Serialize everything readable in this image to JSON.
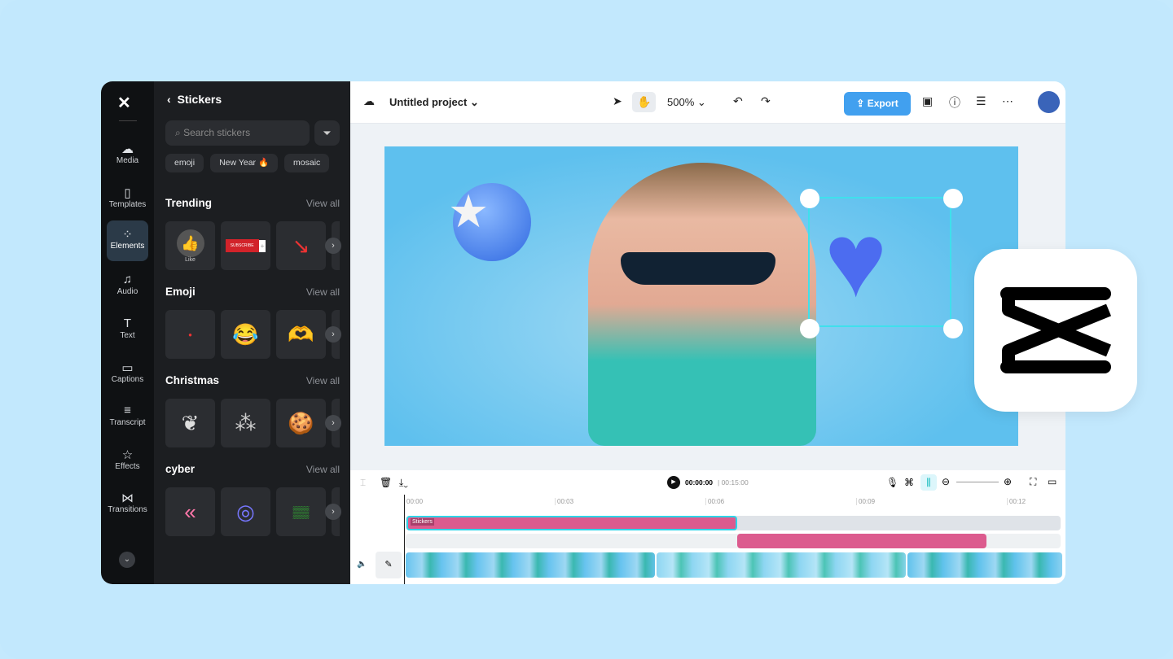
{
  "sidebar": {
    "items": [
      {
        "label": "Media",
        "icon": "cloud-upload-icon"
      },
      {
        "label": "Templates",
        "icon": "templates-icon"
      },
      {
        "label": "Elements",
        "icon": "elements-icon",
        "active": true
      },
      {
        "label": "Audio",
        "icon": "music-icon"
      },
      {
        "label": "Text",
        "icon": "text-icon"
      },
      {
        "label": "Captions",
        "icon": "captions-icon"
      },
      {
        "label": "Transcript",
        "icon": "transcript-icon"
      },
      {
        "label": "Effects",
        "icon": "effects-icon"
      },
      {
        "label": "Transitions",
        "icon": "transitions-icon"
      }
    ]
  },
  "panel": {
    "title": "Stickers",
    "search_placeholder": "Search stickers",
    "chips": [
      "emoji",
      "New Year 🔥",
      "mosaic"
    ],
    "view_all": "View all",
    "sections": [
      {
        "title": "Trending",
        "like_label": "Like",
        "subscribe_label": "SUBSCRIBE"
      },
      {
        "title": "Emoji"
      },
      {
        "title": "Christmas"
      },
      {
        "title": "cyber"
      }
    ]
  },
  "header": {
    "project": "Untitled project",
    "zoom": "500%",
    "export": "Export"
  },
  "timeline": {
    "current": "00:00:00",
    "total": "00:15:00",
    "ticks": [
      "00:00",
      "00:03",
      "00:06",
      "00:09",
      "00:12"
    ],
    "sticker_track": "Stickers"
  },
  "colors": {
    "accent": "#41a0ef",
    "clip": "#dc5b8e",
    "selection": "#3fe0ec"
  }
}
